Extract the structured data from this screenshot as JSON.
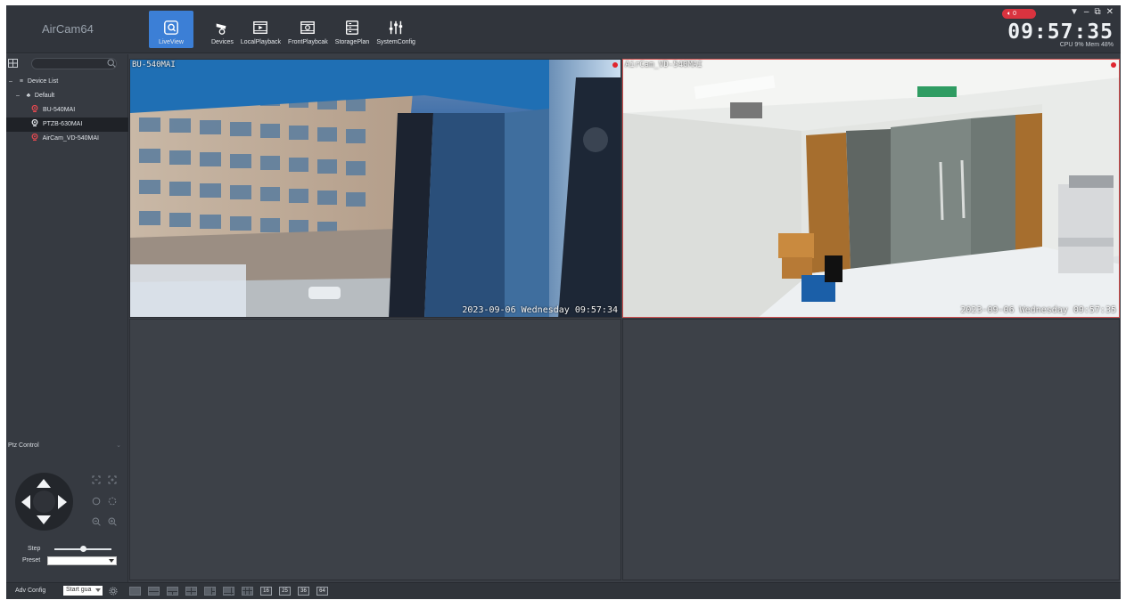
{
  "app": {
    "title": "AirCam64"
  },
  "toolbar": [
    {
      "label": "LiveView",
      "icon": "live-view-icon",
      "active": true
    },
    {
      "label": "Devices",
      "icon": "camera-icon",
      "active": false
    },
    {
      "label": "LocalPlayback",
      "icon": "local-playback-icon",
      "active": false
    },
    {
      "label": "FrontPlaybcak",
      "icon": "front-playback-icon",
      "active": false
    },
    {
      "label": "StoragePlan",
      "icon": "storage-icon",
      "active": false
    },
    {
      "label": "SystemConfig",
      "icon": "sliders-icon",
      "active": false
    }
  ],
  "status": {
    "sound_badge": "0",
    "clock": "09:57:35",
    "stats": "CPU 9%  Mem 48%"
  },
  "sidebar": {
    "search_placeholder": "",
    "tree": {
      "root": "Device List",
      "group": "Default",
      "devices": [
        {
          "name": "BU-540MAI",
          "selected": false,
          "icon_color": "#e0484f"
        },
        {
          "name": "PTZB-630MAI",
          "selected": true,
          "icon_color": "#dfe3e8"
        },
        {
          "name": "AirCam_VD-540MAI",
          "selected": false,
          "icon_color": "#e0484f"
        }
      ]
    },
    "ptz": {
      "title": "Ptz Control",
      "step_label": "Step",
      "step_level": 0.5,
      "preset_label": "Preset",
      "preset_value": ""
    }
  },
  "panes": [
    {
      "title": "BU-540MAI",
      "osd": "2023-09-06 Wednesday 09:57:34",
      "selected": false,
      "recording": true
    },
    {
      "title": "AirCam_VD-540MAI",
      "osd": "2023-09-06 Wednesday 09:57:35",
      "selected": true,
      "recording": true
    },
    {
      "title": "",
      "osd": "",
      "selected": false,
      "recording": false
    },
    {
      "title": "",
      "osd": "",
      "selected": false,
      "recording": false
    }
  ],
  "bottom": {
    "adv_label": "Adv Config",
    "guard_value": "Start gua",
    "layout_numbers": [
      "16",
      "25",
      "36",
      "64"
    ]
  },
  "colors": {
    "accent": "#3c7fd6",
    "selected_border": "#d2504f",
    "record": "#e0252f",
    "background": "#3a3e45"
  }
}
